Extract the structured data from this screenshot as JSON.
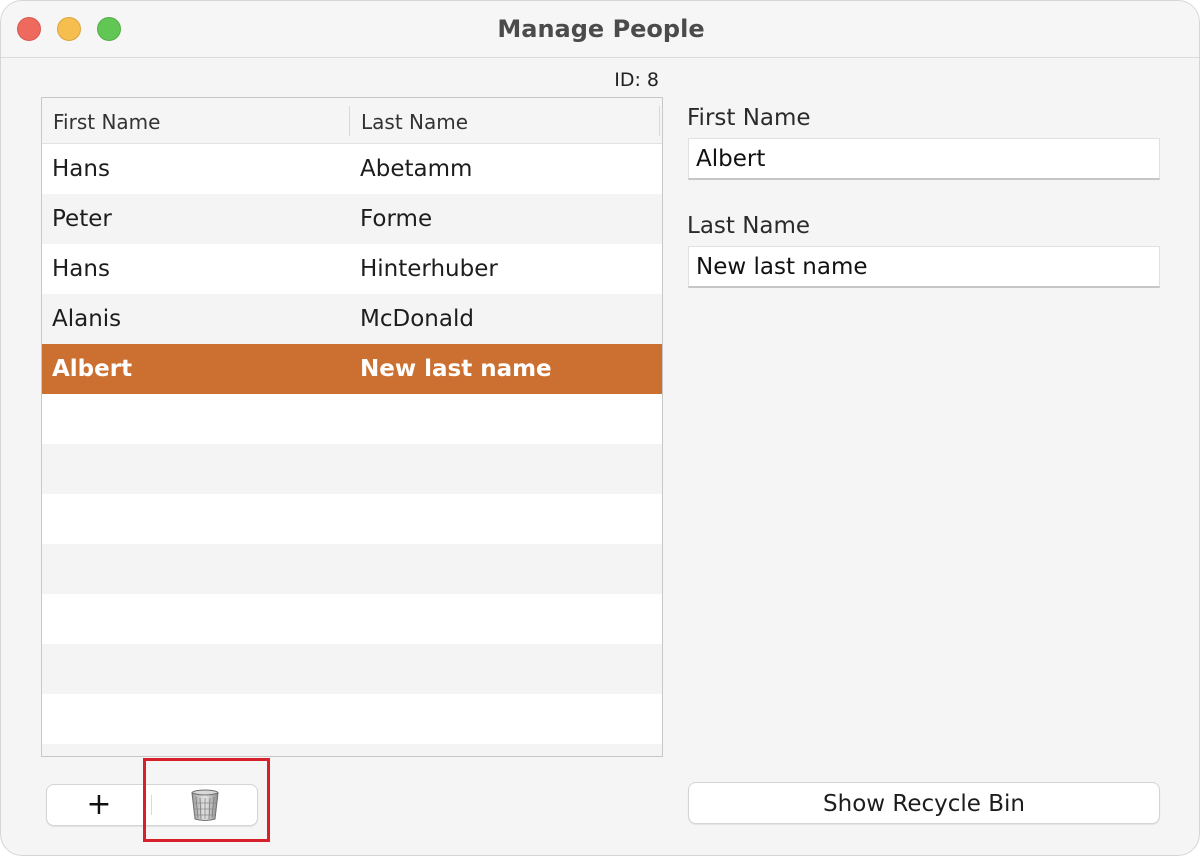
{
  "window": {
    "title": "Manage People"
  },
  "record": {
    "id_label": "ID: 8"
  },
  "table": {
    "columns": [
      "First Name",
      "Last Name"
    ],
    "rows": [
      {
        "first": "Hans",
        "last": "Abetamm"
      },
      {
        "first": "Peter",
        "last": "Forme"
      },
      {
        "first": "Hans",
        "last": "Hinterhuber"
      },
      {
        "first": "Alanis",
        "last": "McDonald"
      },
      {
        "first": "Albert",
        "last": "New last name"
      }
    ],
    "selected_index": 4
  },
  "form": {
    "first_name_label": "First Name",
    "first_name_value": "Albert",
    "last_name_label": "Last Name",
    "last_name_value": "New last name"
  },
  "toolbar": {
    "add_label": "+",
    "add_icon": "plus-icon",
    "delete_icon": "trash-icon"
  },
  "recycle_bin_button": {
    "label": "Show Recycle Bin"
  },
  "colors": {
    "selection": "#cb7030",
    "highlight_box": "#d6202a",
    "close": "#ee6a5f",
    "minimize": "#f5be4f",
    "zoom": "#62c655"
  }
}
